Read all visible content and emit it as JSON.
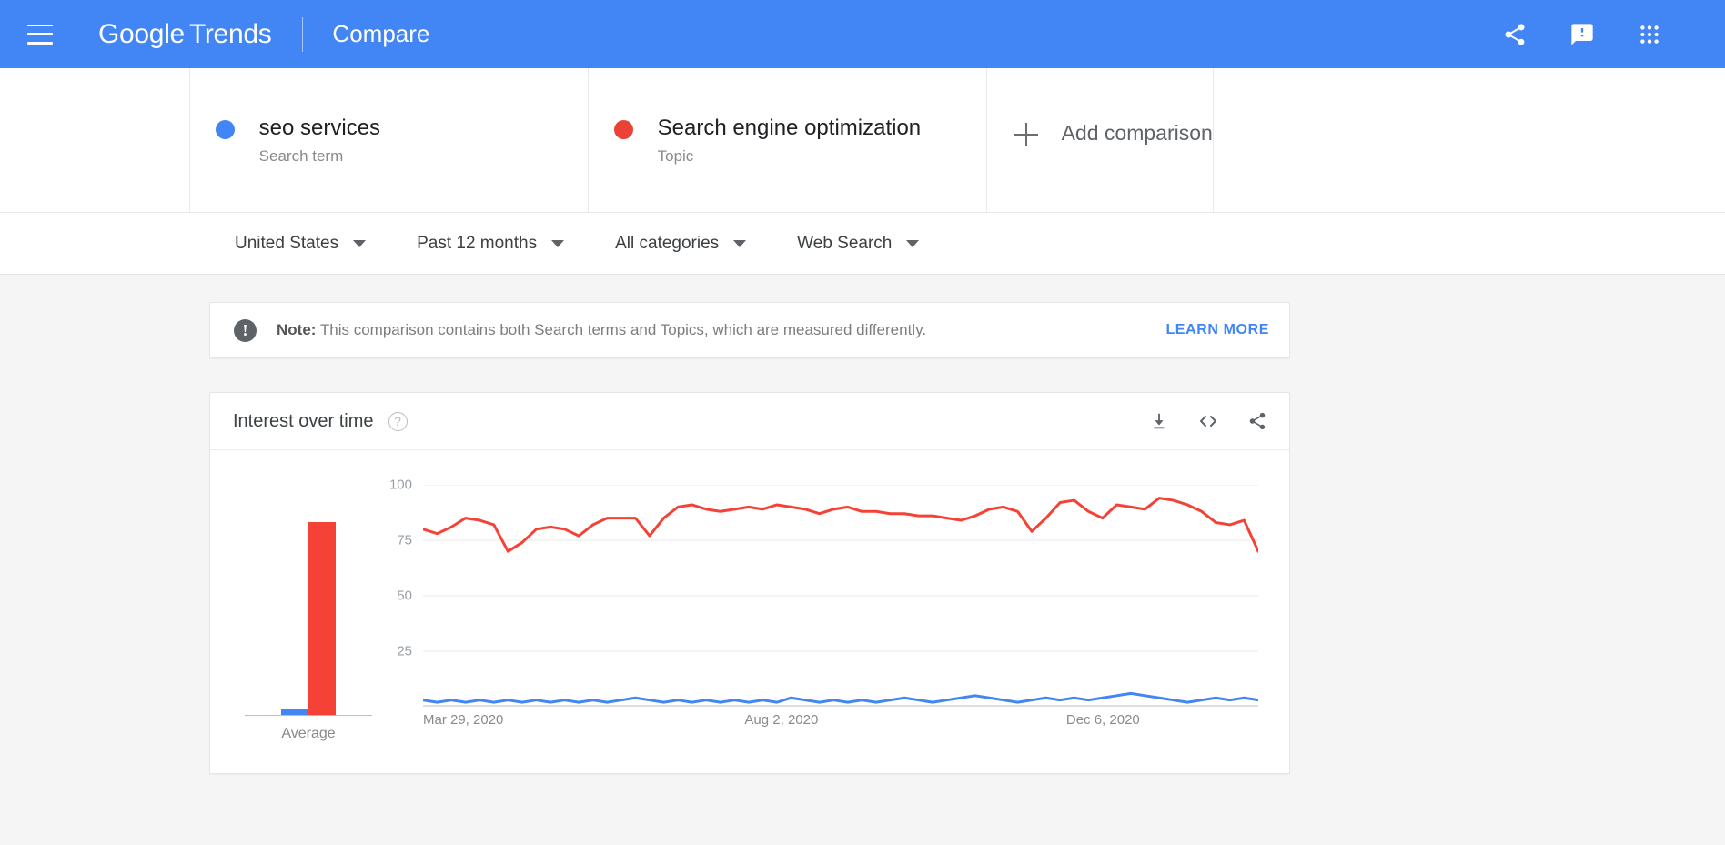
{
  "appbar": {
    "menu_icon": "hamburger-menu-icon",
    "brand_bold": "Google",
    "brand_light": "Trends",
    "page_name": "Compare",
    "icons": [
      {
        "name": "share-icon",
        "label": "Share"
      },
      {
        "name": "feedback-icon",
        "label": "Send feedback"
      },
      {
        "name": "apps-grid-icon",
        "label": "Google apps"
      }
    ],
    "background": "#4285f4"
  },
  "comparison": {
    "items": [
      {
        "title": "seo services",
        "subtitle": "Search term",
        "color": "#4285f4"
      },
      {
        "title": "Search engine optimization",
        "subtitle": "Topic",
        "color": "#ea4335"
      }
    ],
    "add_label": "Add comparison"
  },
  "filters": [
    {
      "label": "United States",
      "name": "filter-location"
    },
    {
      "label": "Past 12 months",
      "name": "filter-time-range"
    },
    {
      "label": "All categories",
      "name": "filter-category"
    },
    {
      "label": "Web Search",
      "name": "filter-search-type"
    }
  ],
  "note": {
    "label": "Note:",
    "text": "This comparison contains both Search terms and Topics, which are measured differently.",
    "learn_more": "LEARN MORE"
  },
  "chart_card": {
    "title": "Interest over time",
    "help_glyph": "?",
    "actions": [
      {
        "name": "download-csv-icon"
      },
      {
        "name": "embed-code-icon"
      },
      {
        "name": "share-icon"
      }
    ]
  },
  "chart_data": [
    {
      "type": "bar",
      "title": "Average",
      "categories": [
        "Average"
      ],
      "series": [
        {
          "name": "seo services",
          "color": "#4285f4",
          "values": [
            3
          ]
        },
        {
          "name": "Search engine optimization",
          "color": "#f44336",
          "values": [
            87
          ]
        }
      ],
      "ylim": [
        0,
        100
      ],
      "grid": false,
      "xlabel": "",
      "ylabel": ""
    },
    {
      "type": "line",
      "title": "Interest over time",
      "xlabel": "",
      "ylabel": "",
      "ylim": [
        0,
        100
      ],
      "yticks": [
        100,
        75,
        50,
        25
      ],
      "grid": true,
      "legend": "none",
      "xtick_labels": [
        "Mar 29, 2020",
        "Aug 2, 2020",
        "Dec 6, 2020"
      ],
      "xtick_positions": [
        0,
        0.385,
        0.77
      ],
      "series": [
        {
          "name": "seo services",
          "color": "#4285f4",
          "values": [
            3,
            2,
            3,
            2,
            3,
            2,
            3,
            2,
            3,
            2,
            3,
            2,
            3,
            2,
            3,
            4,
            3,
            2,
            3,
            2,
            3,
            2,
            3,
            2,
            3,
            2,
            4,
            3,
            2,
            3,
            2,
            3,
            2,
            3,
            4,
            3,
            2,
            3,
            4,
            5,
            4,
            3,
            2,
            3,
            4,
            3,
            4,
            3,
            4,
            5,
            6,
            5,
            4,
            3,
            2,
            3,
            4,
            3,
            4,
            3
          ]
        },
        {
          "name": "Search engine optimization",
          "color": "#f44336",
          "values": [
            80,
            78,
            81,
            85,
            84,
            82,
            70,
            74,
            80,
            81,
            80,
            77,
            82,
            85,
            85,
            85,
            77,
            85,
            90,
            91,
            89,
            88,
            89,
            90,
            89,
            91,
            90,
            89,
            87,
            89,
            90,
            88,
            88,
            87,
            87,
            86,
            86,
            85,
            84,
            86,
            89,
            90,
            88,
            79,
            85,
            92,
            93,
            88,
            85,
            91,
            90,
            89,
            94,
            93,
            91,
            88,
            83,
            82,
            84,
            70
          ]
        }
      ]
    }
  ]
}
